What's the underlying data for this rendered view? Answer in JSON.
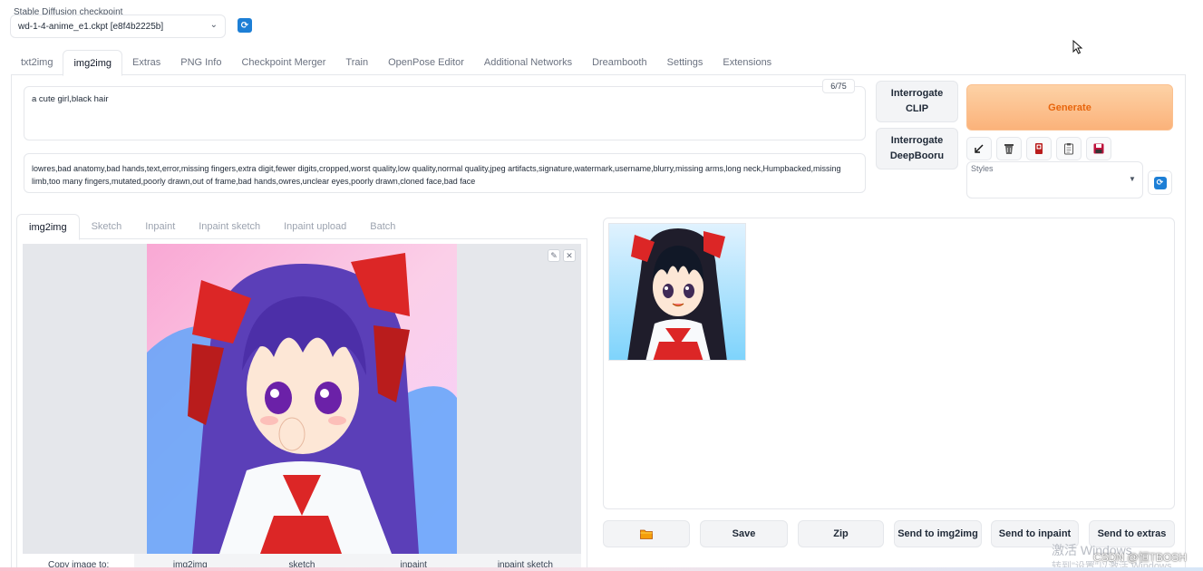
{
  "checkpoint": {
    "label": "Stable Diffusion checkpoint",
    "value": "wd-1-4-anime_e1.ckpt [e8f4b2225b]"
  },
  "main_tabs": [
    {
      "label": "txt2img",
      "active": false
    },
    {
      "label": "img2img",
      "active": true
    },
    {
      "label": "Extras",
      "active": false
    },
    {
      "label": "PNG Info",
      "active": false
    },
    {
      "label": "Checkpoint Merger",
      "active": false
    },
    {
      "label": "Train",
      "active": false
    },
    {
      "label": "OpenPose Editor",
      "active": false
    },
    {
      "label": "Additional Networks",
      "active": false
    },
    {
      "label": "Dreambooth",
      "active": false
    },
    {
      "label": "Settings",
      "active": false
    },
    {
      "label": "Extensions",
      "active": false
    }
  ],
  "prompt": {
    "value": "a cute girl,black hair",
    "token_count": "6/75"
  },
  "negative_prompt": {
    "value": "lowres,bad anatomy,bad hands,text,error,missing fingers,extra digit,fewer digits,cropped,worst quality,low quality,normal quality,jpeg artifacts,signature,watermark,username,blurry,missing arms,long neck,Humpbacked,missing limb,too many fingers,mutated,poorly drawn,out of frame,bad hands,owres,unclear eyes,poorly drawn,cloned face,bad face"
  },
  "interrogate": {
    "clip_label": "Interrogate CLIP",
    "deepbooru_label": "Interrogate DeepBooru"
  },
  "generate": {
    "label": "Generate",
    "accent": "#fbb27a"
  },
  "tools": [
    {
      "icon": "arrow-diagonal-icon"
    },
    {
      "icon": "trash-icon"
    },
    {
      "icon": "red-card-icon"
    },
    {
      "icon": "clipboard-icon"
    },
    {
      "icon": "save-disk-icon"
    }
  ],
  "styles": {
    "label": "Styles"
  },
  "sub_tabs": [
    {
      "label": "img2img",
      "active": true
    },
    {
      "label": "Sketch",
      "active": false
    },
    {
      "label": "Inpaint",
      "active": false
    },
    {
      "label": "Inpaint sketch",
      "active": false
    },
    {
      "label": "Inpaint upload",
      "active": false
    },
    {
      "label": "Batch",
      "active": false
    }
  ],
  "copy_row": [
    "Copy image to:",
    "img2img",
    "sketch",
    "inpaint",
    "inpaint sketch"
  ],
  "output_buttons": [
    {
      "label": "",
      "icon": "folder-icon"
    },
    {
      "label": "Save"
    },
    {
      "label": "Zip"
    },
    {
      "label": "Send to img2img"
    },
    {
      "label": "Send to inpaint"
    },
    {
      "label": "Send to extras"
    }
  ],
  "watermark": {
    "activate_line1": "激活 Windows",
    "activate_line2": "转到\"设置\"以激活 Windows",
    "csdn": "CSDN @恒TBOSH"
  },
  "colors": {
    "refresh": "#1d7fd6",
    "generate_text": "#e8650c"
  }
}
